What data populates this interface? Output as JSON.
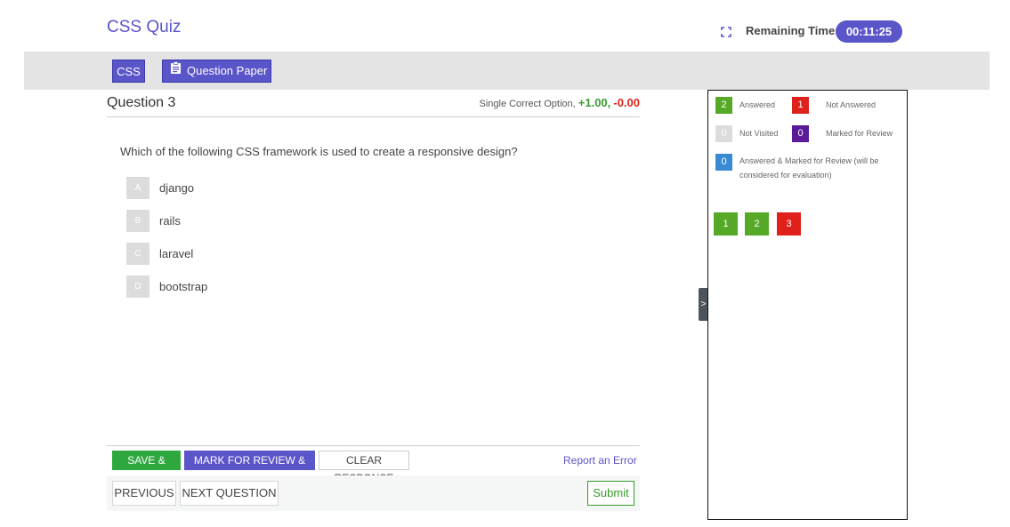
{
  "header": {
    "title": "CSS Quiz",
    "timer_label": "Remaining Time:",
    "timer_value": "00:11:25",
    "fullscreen_icon": "fullscreen-icon"
  },
  "tabs": {
    "css_label": "CSS",
    "question_paper_label": "Question Paper",
    "question_paper_icon": "clipboard-icon"
  },
  "question": {
    "number_label": "Question 3",
    "type_label": "Single Correct Option,",
    "positive_marks": "+1.00",
    "separator": ",",
    "negative_marks": "-0.00",
    "text": "Which of the following CSS framework is used to create a responsive design?",
    "options": [
      {
        "letter": "A",
        "text": "django"
      },
      {
        "letter": "B",
        "text": "rails"
      },
      {
        "letter": "C",
        "text": "laravel"
      },
      {
        "letter": "D",
        "text": "bootstrap"
      }
    ]
  },
  "actions": {
    "save_next": "SAVE & NEXT",
    "mark_review_next": "MARK FOR REVIEW & NEXT",
    "clear_response": "CLEAR RESPONSE",
    "report_error": "Report an Error",
    "previous": "PREVIOUS",
    "next_question": "NEXT QUESTION",
    "submit": "Submit"
  },
  "side_panel": {
    "toggle_label": ">",
    "legend": {
      "answered": {
        "count": "2",
        "label": "Answered"
      },
      "not_answered": {
        "count": "1",
        "label": "Not Answered"
      },
      "not_visited": {
        "count": "0",
        "label": "Not Visited"
      },
      "marked_for_review": {
        "count": "0",
        "label": "Marked for Review"
      },
      "answered_marked": {
        "count": "0",
        "label_line1": "Answered & Marked for Review (will be",
        "label_line2": "considered for evaluation)"
      }
    },
    "palette": [
      {
        "number": "1",
        "status": "answered"
      },
      {
        "number": "2",
        "status": "answered"
      },
      {
        "number": "3",
        "status": "not_answered"
      }
    ]
  },
  "colors": {
    "brand": "#5a55c8",
    "answered": "#56a927",
    "not_answered": "#e0201b",
    "not_visited": "#dcdcdc",
    "marked_for_review": "#5b1a98",
    "answered_marked": "#3a8ad3",
    "save_green": "#2ea83e"
  }
}
